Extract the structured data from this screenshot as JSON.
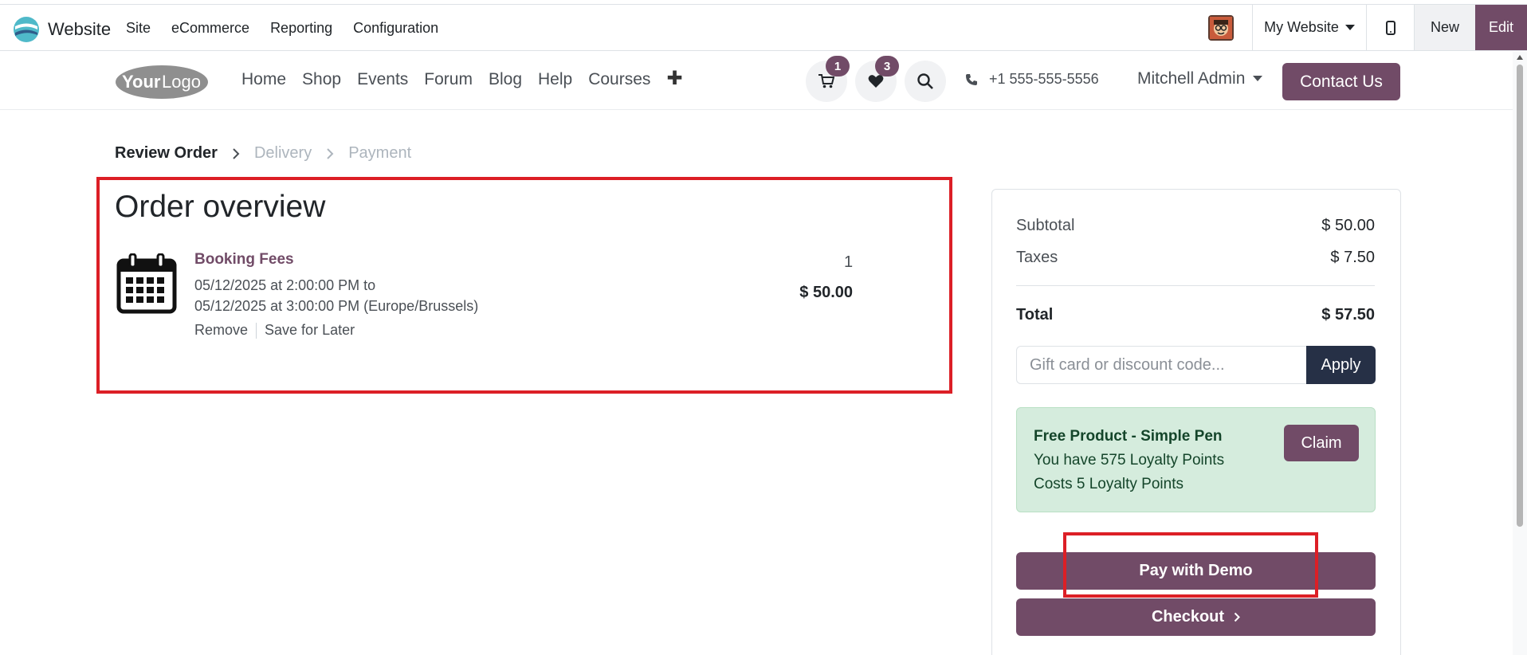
{
  "admin_bar": {
    "app_name": "Website",
    "menu": [
      "Site",
      "eCommerce",
      "Reporting",
      "Configuration"
    ],
    "website_selector": "My Website",
    "new_label": "New",
    "edit_label": "Edit"
  },
  "site_header": {
    "logo_text": "YourLogo",
    "nav": [
      "Home",
      "Shop",
      "Events",
      "Forum",
      "Blog",
      "Help",
      "Courses"
    ],
    "cart_count": "1",
    "wishlist_count": "3",
    "phone": "+1 555-555-5556",
    "user_name": "Mitchell Admin",
    "contact_label": "Contact Us"
  },
  "steps": {
    "review": "Review Order",
    "delivery": "Delivery",
    "payment": "Payment"
  },
  "order": {
    "title": "Order overview",
    "item": {
      "name": "Booking Fees",
      "line1": "05/12/2025 at 2:00:00 PM to",
      "line2": "05/12/2025 at 3:00:00 PM (Europe/Brussels)",
      "remove": "Remove",
      "save_later": "Save for Later",
      "quantity": "1",
      "price": "$ 50.00"
    }
  },
  "summary": {
    "subtotal_label": "Subtotal",
    "subtotal": "$ 50.00",
    "taxes_label": "Taxes",
    "taxes": "$ 7.50",
    "total_label": "Total",
    "total": "$ 57.50",
    "promo_placeholder": "Gift card or discount code...",
    "apply_label": "Apply",
    "reward": {
      "title": "Free Product - Simple Pen",
      "line1": "You have 575 Loyalty Points",
      "line2": "Costs 5 Loyalty Points",
      "claim_label": "Claim"
    },
    "pay_label": "Pay with Demo",
    "checkout_label": "Checkout"
  },
  "colors": {
    "brand": "#714b67",
    "highlight": "#dc1f26",
    "reward_bg": "#d5ecdd",
    "apply_bg": "#263046"
  }
}
